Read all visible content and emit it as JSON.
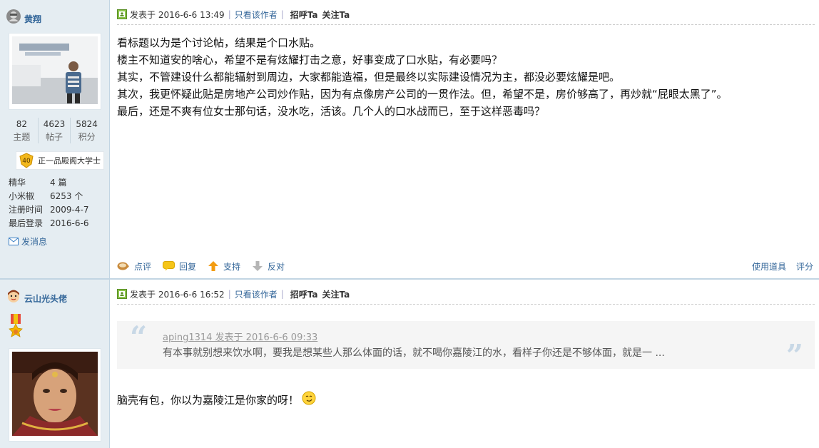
{
  "posts": [
    {
      "author": {
        "name": "黄翔",
        "stats": [
          {
            "num": "82",
            "label": "主题"
          },
          {
            "num": "4623",
            "label": "帖子"
          },
          {
            "num": "5824",
            "label": "积分"
          }
        ],
        "rank_level": "40",
        "rank_title": "正一品殿阁大学士",
        "info": [
          {
            "k": "精华",
            "v": "4 篇"
          },
          {
            "k": "小米椒",
            "v": "6253 个"
          },
          {
            "k": "注册时间",
            "v": "2009-4-7"
          },
          {
            "k": "最后登录",
            "v": "2016-6-6"
          }
        ],
        "message_label": "发消息"
      },
      "meta": {
        "posted": "发表于 2016-6-6 13:49",
        "only_author": "只看该作者",
        "greet": "招呼Ta",
        "follow": "关注Ta"
      },
      "content": [
        "看标题以为是个讨论帖，结果是个口水贴。",
        "楼主不知道安的啥心，希望不是有炫耀打击之意，好事变成了口水贴，有必要吗？",
        "其实，不管建设什么都能辐射到周边，大家都能造福，但是最终以实际建设情况为主，都没必要炫耀是吧。",
        "其次，我更怀疑此贴是房地产公司炒作贴，因为有点像房产公司的一贯作法。但，希望不是，房价够高了，再炒就“屁眼太黑了”。",
        "最后，还是不爽有位女士那句话，没水吃，活该。几个人的口水战而已，至于这样恶毒吗？"
      ],
      "actions": {
        "comment": "点评",
        "reply": "回复",
        "support": "支持",
        "oppose": "反对",
        "tools": "使用道具",
        "rate": "评分"
      }
    },
    {
      "author": {
        "name": "云山光头佬"
      },
      "meta": {
        "posted": "发表于 2016-6-6 16:52",
        "only_author": "只看该作者",
        "greet": "招呼Ta",
        "follow": "关注Ta"
      },
      "quote": {
        "meta": "aping1314 发表于 2016-6-6 09:33",
        "text": "有本事就别想来饮水啊，要我是想某些人那么体面的话，就不喝你嘉陵江的水，看样子你还是不够体面，就是一 ..."
      },
      "reply": "脑壳有包，你以为嘉陵江是你家的呀！"
    }
  ],
  "colors": {
    "sidebar_bg": "#e5edf2",
    "link": "#336699",
    "quote_bg": "#f5f5f5"
  }
}
